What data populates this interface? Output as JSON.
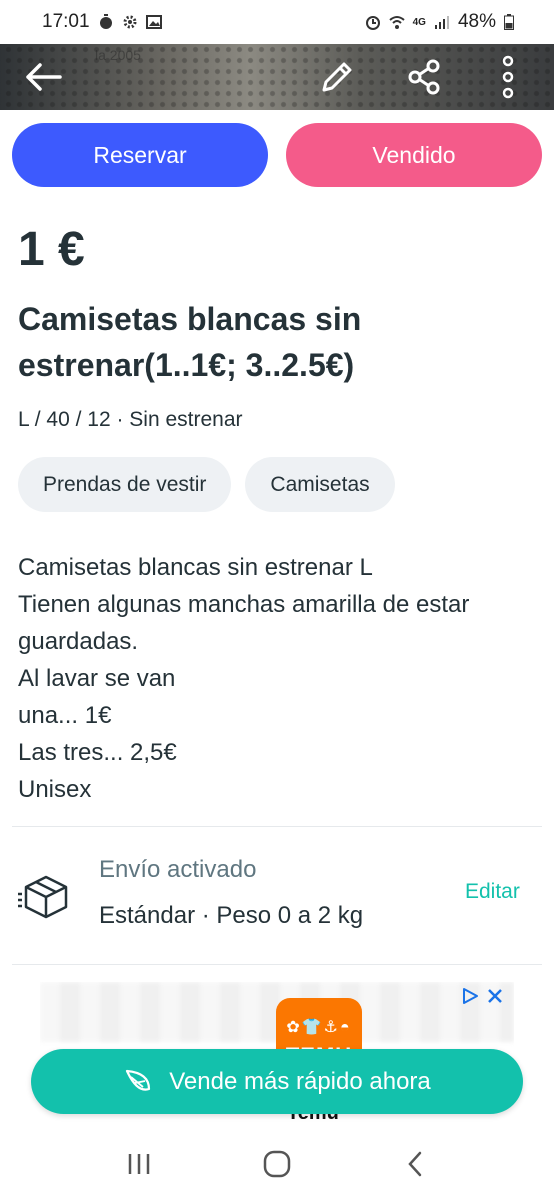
{
  "status_bar": {
    "time": "17:01",
    "network": "4G",
    "battery": "48%"
  },
  "hero": {
    "faint_text": "la 2005",
    "icons": [
      "back-arrow-icon",
      "edit-pencil-icon",
      "share-icon",
      "more-vertical-icon"
    ]
  },
  "actions": {
    "reserve_label": "Reservar",
    "sold_label": "Vendido"
  },
  "item": {
    "price": "1 €",
    "title": "Camisetas blancas sin estrenar(1..1€; 3..2.5€)",
    "attributes": "L / 40 / 12 · Sin estrenar",
    "categories": [
      "Prendas de vestir",
      "Camisetas"
    ],
    "description": "Camisetas blancas sin estrenar L\nTienen algunas manchas amarilla de estar guardadas.\nAl lavar se van\nuna... 1€\nLas tres... 2,5€\nUnisex"
  },
  "shipping": {
    "title": "Envío activado",
    "detail": "Estándar · Peso 0 a 2 kg",
    "edit_label": "Editar"
  },
  "ad": {
    "brand": "Temu",
    "logo_text": "TEMU"
  },
  "promo": {
    "label": "Vende más rápido ahora"
  },
  "colors": {
    "reserve": "#3d5afe",
    "sold": "#f45b8a",
    "accent": "#13c1ac",
    "text": "#253238"
  }
}
